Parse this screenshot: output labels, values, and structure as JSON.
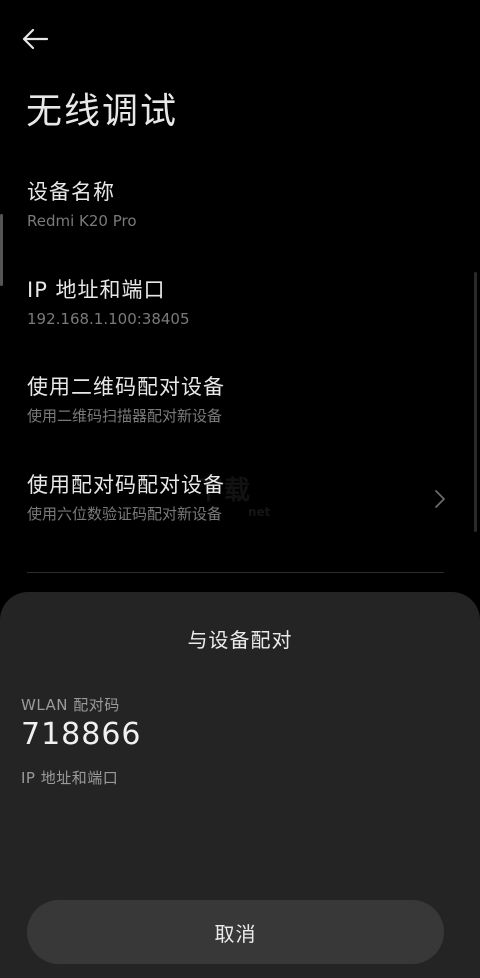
{
  "header": {
    "back_icon": "back-arrow-icon",
    "title": "无线调试"
  },
  "settings": [
    {
      "title": "设备名称",
      "subtitle": "Redmi K20 Pro"
    },
    {
      "title": "IP 地址和端口",
      "subtitle": "192.168.1.100:38405"
    },
    {
      "title": "使用二维码配对设备",
      "subtitle": "使用二维码扫描器配对新设备"
    },
    {
      "title": "使用配对码配对设备",
      "subtitle": "使用六位数验证码配对新设备",
      "chevron_icon": "chevron-right-icon"
    }
  ],
  "watermark": {
    "main": "下载",
    "sub": "net"
  },
  "dialog": {
    "title": "与设备配对",
    "pairing_code_label": "WLAN 配对码",
    "pairing_code": "718866",
    "ip_label": "IP 地址和端口",
    "cancel_label": "取消"
  },
  "colors": {
    "background": "#000000",
    "sheet": "#242424",
    "button": "#383838",
    "primary_text": "#e8e8e8",
    "secondary_text": "#7a7a7a"
  }
}
